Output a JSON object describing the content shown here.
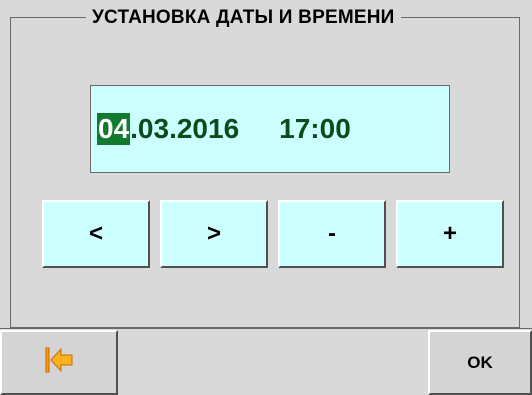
{
  "dialog": {
    "title": "УСТАНОВКА ДАТЫ И ВРЕМЕНИ"
  },
  "datetime": {
    "day": "04",
    "date_rest": ".03.2016",
    "time": "17:00",
    "selected_segment": "day"
  },
  "controls": {
    "left_label": "<",
    "right_label": ">",
    "minus_label": "-",
    "plus_label": "+"
  },
  "footer": {
    "back_icon": "back-arrow-icon",
    "ok_label": "OK"
  },
  "colors": {
    "panel_bg": "#d9d9d9",
    "field_bg": "#ccffff",
    "text_green": "#0a4d1c",
    "selection_bg": "#117a2c",
    "icon_orange": "#ff9a00"
  }
}
